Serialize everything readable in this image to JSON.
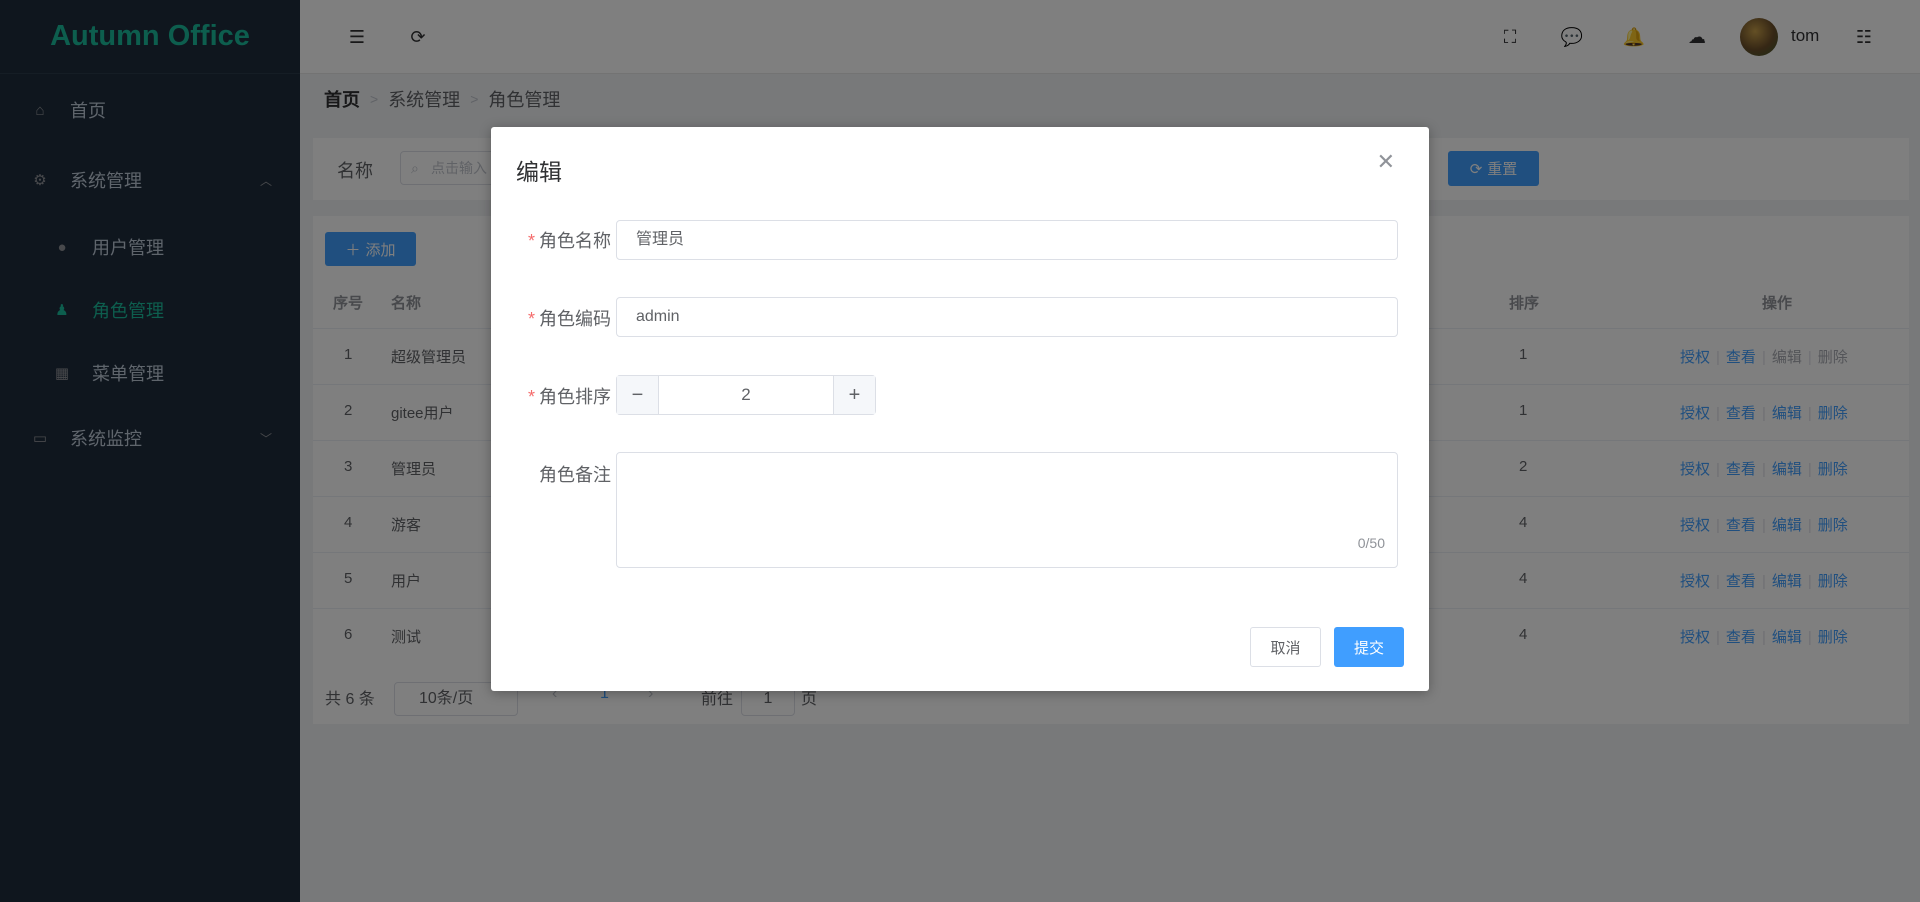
{
  "app": {
    "logo": "Autumn Office"
  },
  "sidebar": {
    "items": [
      {
        "label": "首页",
        "icon": "home-icon"
      },
      {
        "label": "系统管理",
        "icon": "gear-icon",
        "expanded": true
      },
      {
        "label": "用户管理",
        "icon": "user-icon"
      },
      {
        "label": "角色管理",
        "icon": "role-icon",
        "active": true
      },
      {
        "label": "菜单管理",
        "icon": "grid-icon"
      },
      {
        "label": "系统监控",
        "icon": "monitor-icon",
        "expanded": false
      }
    ]
  },
  "header": {
    "username": "tom"
  },
  "breadcrumb": [
    "首页",
    "系统管理",
    "角色管理"
  ],
  "search": {
    "label": "名称",
    "placeholder": "点击输入",
    "reset_label": "重置"
  },
  "toolbar": {
    "add_label": "添加"
  },
  "table": {
    "headers": {
      "index": "序号",
      "name": "名称",
      "sort": "排序",
      "ops": "操作"
    },
    "rows": [
      {
        "index": "1",
        "name": "超级管理员",
        "sort": "1",
        "edit_disabled": true
      },
      {
        "index": "2",
        "name": "gitee用户",
        "sort": "1"
      },
      {
        "index": "3",
        "name": "管理员",
        "sort": "2"
      },
      {
        "index": "4",
        "name": "游客",
        "sort": "4"
      },
      {
        "index": "5",
        "name": "用户",
        "sort": "4"
      },
      {
        "index": "6",
        "name": "测试",
        "sort": "4"
      }
    ],
    "ops": {
      "grant": "授权",
      "view": "查看",
      "edit": "编辑",
      "delete": "删除"
    }
  },
  "pagination": {
    "total": "共 6 条",
    "page_size": "10条/页",
    "current": "1",
    "goto_prefix": "前往",
    "goto_value": "1",
    "goto_suffix": "页"
  },
  "dialog": {
    "title": "编辑",
    "fields": {
      "name_label": "角色名称",
      "name_value": "管理员",
      "code_label": "角色编码",
      "code_value": "admin",
      "sort_label": "角色排序",
      "sort_value": "2",
      "remark_label": "角色备注",
      "remark_count": "0/50"
    },
    "cancel_label": "取消",
    "submit_label": "提交"
  },
  "colors": {
    "primary": "#409eff",
    "accent": "#1abc9c",
    "sidebar_bg": "#1f2d3d"
  }
}
